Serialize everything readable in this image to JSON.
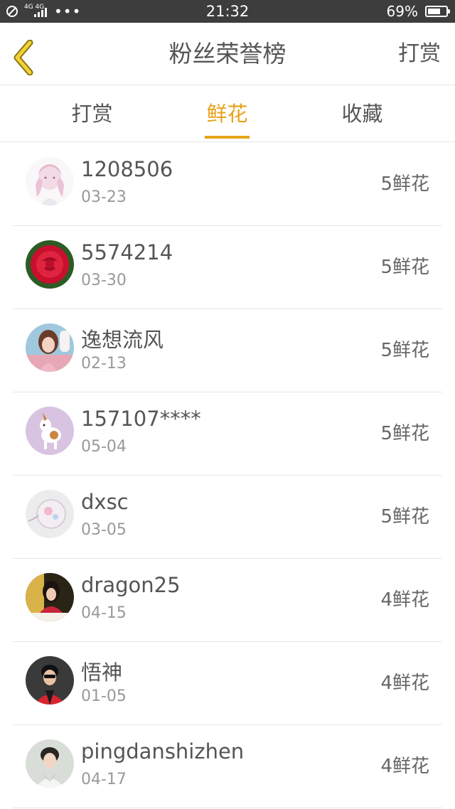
{
  "status_bar": {
    "network": "4G 4G",
    "dots": "•••",
    "time": "21:32",
    "battery": "69%",
    "battery_level": 0.69
  },
  "header": {
    "title": "粉丝荣誉榜",
    "action": "打赏"
  },
  "tabs": [
    {
      "label": "打赏",
      "active": false
    },
    {
      "label": "鲜花",
      "active": true
    },
    {
      "label": "收藏",
      "active": false
    }
  ],
  "list": [
    {
      "name": "1208506",
      "date": "03-23",
      "amount": "5鲜花",
      "avatar": "anime-girl-sketch"
    },
    {
      "name": "5574214",
      "date": "03-30",
      "amount": "5鲜花",
      "avatar": "red-rose"
    },
    {
      "name": "逸想流风",
      "date": "02-13",
      "amount": "5鲜花",
      "avatar": "girl-portrait"
    },
    {
      "name": "157107****",
      "date": "05-04",
      "amount": "5鲜花",
      "avatar": "toy-dog"
    },
    {
      "name": "dxsc",
      "date": "03-05",
      "amount": "5鲜花",
      "avatar": "glass-ball"
    },
    {
      "name": "dragon25",
      "date": "04-15",
      "amount": "4鲜花",
      "avatar": "girl-dark"
    },
    {
      "name": "悟神",
      "date": "01-05",
      "amount": "4鲜花",
      "avatar": "man-red-jacket"
    },
    {
      "name": "pingdanshizhen",
      "date": "04-17",
      "amount": "4鲜花",
      "avatar": "boy-portrait"
    }
  ],
  "colors": {
    "accent": "#e8a21a",
    "status_bar": "#3d3d3d",
    "text": "#555555",
    "subtext": "#999999",
    "divider": "#e6e6e6"
  }
}
